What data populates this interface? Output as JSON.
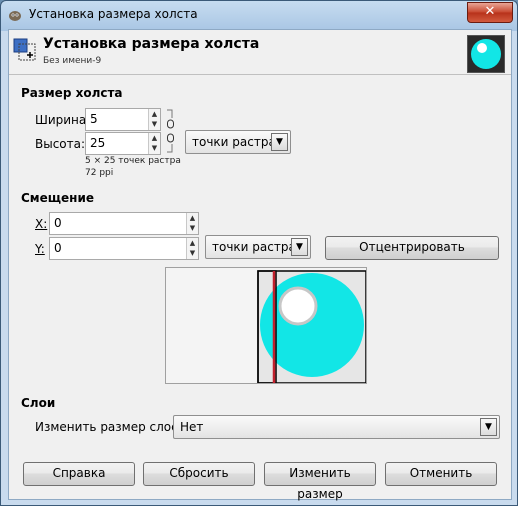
{
  "window": {
    "title": "Установка размера холста"
  },
  "header": {
    "title": "Установка размера холста",
    "subtitle": "Без имени-9"
  },
  "canvas_size": {
    "section_label": "Размер холста",
    "width_label": "Ширина:",
    "width_value": "5",
    "height_label": "Высота:",
    "height_value": "25",
    "unit": "точки растра",
    "info_size": "5 × 25 точек растра",
    "info_ppi": "72 ppi"
  },
  "offset": {
    "section_label": "Смещение",
    "x_label": "X:",
    "x_value": "0",
    "y_label": "Y:",
    "y_value": "0",
    "unit": "точки растра",
    "center_button": "Отцентрировать"
  },
  "layers": {
    "section_label": "Слои",
    "resize_label": "Изменить размер слоев:",
    "resize_value": "Нет"
  },
  "buttons": {
    "help": "Справка",
    "reset": "Сбросить",
    "resize": "Изменить размер",
    "cancel": "Отменить"
  },
  "colors": {
    "accent": "#12e6e6",
    "highlight": "#ffffff"
  },
  "icons": [
    "gimp-icon",
    "close-icon",
    "canvas-size-icon",
    "chain-icon",
    "dropdown-arrow-icon",
    "spin-up-icon",
    "spin-down-icon"
  ]
}
